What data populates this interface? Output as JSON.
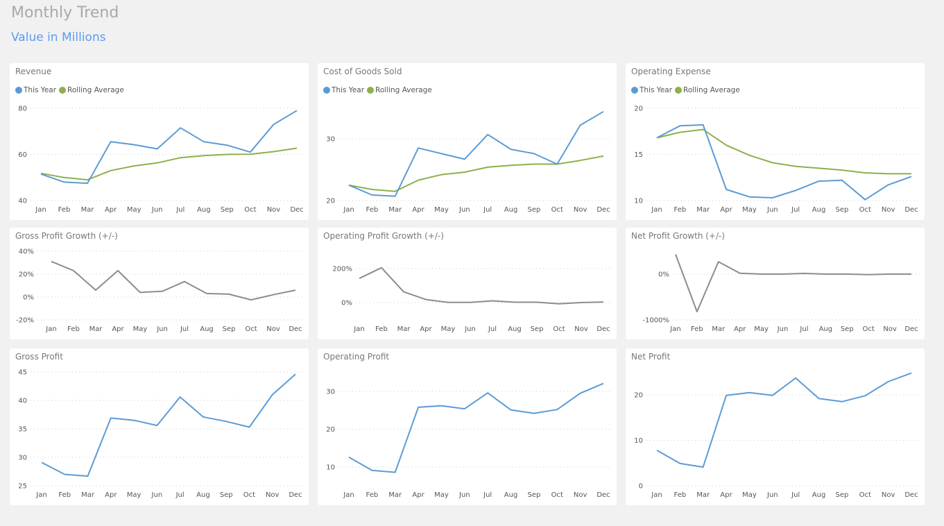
{
  "header": {
    "title": "Monthly Trend",
    "subtitle": "Value in Millions"
  },
  "colors": {
    "this_year": "#5b9bd5",
    "rolling_average": "#8db04a",
    "growth": "#8c8c8c"
  },
  "chart_data": [
    {
      "id": "revenue",
      "type": "line",
      "title": "Revenue",
      "categories": [
        "Jan",
        "Feb",
        "Mar",
        "Apr",
        "May",
        "Jun",
        "Jul",
        "Aug",
        "Sep",
        "Oct",
        "Nov",
        "Dec"
      ],
      "yticks": [
        {
          "v": 40,
          "label": "40"
        },
        {
          "v": 60,
          "label": "60"
        },
        {
          "v": 80,
          "label": "80"
        }
      ],
      "ylim": [
        40,
        80
      ],
      "legend": [
        "This Year",
        "Rolling Average"
      ],
      "series": [
        {
          "name": "This Year",
          "color": "#5b9bd5",
          "values": [
            51.5,
            48,
            47.5,
            65.5,
            64.2,
            62.4,
            71.5,
            65.5,
            64,
            61,
            73,
            79
          ]
        },
        {
          "name": "Rolling Average",
          "color": "#8db04a",
          "values": [
            51.8,
            50,
            49,
            53,
            55,
            56.3,
            58.6,
            59.5,
            60,
            60.1,
            61.2,
            62.7
          ]
        }
      ]
    },
    {
      "id": "cogs",
      "type": "line",
      "title": "Cost of Goods Sold",
      "categories": [
        "Jan",
        "Feb",
        "Mar",
        "Apr",
        "May",
        "Jun",
        "Jul",
        "Aug",
        "Sep",
        "Oct",
        "Nov",
        "Dec"
      ],
      "yticks": [
        {
          "v": 20,
          "label": "20"
        },
        {
          "v": 30,
          "label": "30"
        }
      ],
      "ylim": [
        20,
        30
      ],
      "legend": [
        "This Year",
        "Rolling Average"
      ],
      "series": [
        {
          "name": "This Year",
          "color": "#5b9bd5",
          "values": [
            22.5,
            20.9,
            20.7,
            28.5,
            27.6,
            26.7,
            30.7,
            28.3,
            27.6,
            25.9,
            32.2,
            34.4
          ]
        },
        {
          "name": "Rolling Average",
          "color": "#8db04a",
          "values": [
            22.5,
            21.8,
            21.5,
            23.3,
            24.2,
            24.6,
            25.4,
            25.7,
            25.9,
            25.9,
            26.5,
            27.2
          ]
        }
      ]
    },
    {
      "id": "opex",
      "type": "line",
      "title": "Operating Expense",
      "categories": [
        "Jan",
        "Feb",
        "Mar",
        "Apr",
        "May",
        "Jun",
        "Jul",
        "Aug",
        "Sep",
        "Oct",
        "Nov",
        "Dec"
      ],
      "yticks": [
        {
          "v": 10,
          "label": "10"
        },
        {
          "v": 15,
          "label": "15"
        },
        {
          "v": 20,
          "label": "20"
        }
      ],
      "ylim": [
        10,
        20
      ],
      "legend": [
        "This Year",
        "Rolling Average"
      ],
      "series": [
        {
          "name": "This Year",
          "color": "#5b9bd5",
          "values": [
            16.8,
            18.1,
            18.2,
            11.2,
            10.4,
            10.3,
            11.1,
            12.1,
            12.2,
            10.1,
            11.7,
            12.6
          ]
        },
        {
          "name": "Rolling Average",
          "color": "#8db04a",
          "values": [
            16.8,
            17.4,
            17.7,
            16.0,
            14.9,
            14.1,
            13.7,
            13.5,
            13.3,
            13.0,
            12.9,
            12.9
          ]
        }
      ]
    },
    {
      "id": "gross-profit-growth",
      "type": "line",
      "title": "Gross Profit Growth (+/-)",
      "categories": [
        "Jan",
        "Feb",
        "Mar",
        "Apr",
        "May",
        "Jun",
        "Jul",
        "Aug",
        "Sep",
        "Oct",
        "Nov",
        "Dec"
      ],
      "yticks": [
        {
          "v": -20,
          "label": "-20%"
        },
        {
          "v": 0,
          "label": "0%"
        },
        {
          "v": 20,
          "label": "20%"
        },
        {
          "v": 40,
          "label": "40%"
        }
      ],
      "ylim": [
        -20,
        40
      ],
      "unit": "%",
      "series": [
        {
          "name": "Gross Profit Growth",
          "color": "#8c8c8c",
          "values": [
            31,
            23,
            6,
            23,
            4,
            5,
            13.5,
            3,
            2.5,
            -2.5,
            2,
            6
          ]
        }
      ]
    },
    {
      "id": "operating-profit-growth",
      "type": "line",
      "title": "Operating Profit Growth (+/-)",
      "categories": [
        "Jan",
        "Feb",
        "Mar",
        "Apr",
        "May",
        "Jun",
        "Jul",
        "Aug",
        "Sep",
        "Oct",
        "Nov",
        "Dec"
      ],
      "yticks": [
        {
          "v": 0,
          "label": "0%"
        },
        {
          "v": 200,
          "label": "200%"
        }
      ],
      "ylim": [
        -135,
        345
      ],
      "unit": "%",
      "series": [
        {
          "name": "Operating Profit Growth",
          "color": "#8c8c8c",
          "values": [
            142,
            205,
            63,
            18,
            1,
            1,
            10,
            2,
            2,
            -7,
            0,
            3
          ]
        }
      ]
    },
    {
      "id": "net-profit-growth",
      "type": "line",
      "title": "Net Profit Growth (+/-)",
      "categories": [
        "Jan",
        "Feb",
        "Mar",
        "Apr",
        "May",
        "Jun",
        "Jul",
        "Aug",
        "Sep",
        "Oct",
        "Nov",
        "Dec"
      ],
      "yticks": [
        {
          "v": -1000,
          "label": "-1000%"
        },
        {
          "v": 0,
          "label": "0%"
        }
      ],
      "ylim": [
        -1000,
        500
      ],
      "unit": "%",
      "series": [
        {
          "name": "Net Profit Growth",
          "color": "#8c8c8c",
          "values": [
            430,
            -820,
            270,
            20,
            0,
            0,
            15,
            0,
            0,
            -10,
            0,
            0
          ]
        }
      ]
    },
    {
      "id": "gross-profit",
      "type": "line",
      "title": "Gross Profit",
      "categories": [
        "Jan",
        "Feb",
        "Mar",
        "Apr",
        "May",
        "Jun",
        "Jul",
        "Aug",
        "Sep",
        "Oct",
        "Nov",
        "Dec"
      ],
      "yticks": [
        {
          "v": 25,
          "label": "25"
        },
        {
          "v": 30,
          "label": "30"
        },
        {
          "v": 35,
          "label": "35"
        },
        {
          "v": 40,
          "label": "40"
        },
        {
          "v": 45,
          "label": "45"
        }
      ],
      "ylim": [
        25,
        45
      ],
      "series": [
        {
          "name": "Gross Profit",
          "color": "#5b9bd5",
          "values": [
            29.1,
            27.0,
            26.7,
            36.9,
            36.5,
            35.6,
            40.6,
            37.1,
            36.3,
            35.3,
            41.0,
            44.6
          ]
        }
      ]
    },
    {
      "id": "operating-profit",
      "type": "line",
      "title": "Operating Profit",
      "categories": [
        "Jan",
        "Feb",
        "Mar",
        "Apr",
        "May",
        "Jun",
        "Jul",
        "Aug",
        "Sep",
        "Oct",
        "Nov",
        "Dec"
      ],
      "yticks": [
        {
          "v": 10,
          "label": "10"
        },
        {
          "v": 20,
          "label": "20"
        },
        {
          "v": 30,
          "label": "30"
        }
      ],
      "ylim": [
        5,
        35
      ],
      "series": [
        {
          "name": "Operating Profit",
          "color": "#5b9bd5",
          "values": [
            12.6,
            9.1,
            8.6,
            25.8,
            26.2,
            25.4,
            29.6,
            25.1,
            24.2,
            25.2,
            29.5,
            32.1
          ]
        }
      ]
    },
    {
      "id": "net-profit",
      "type": "line",
      "title": "Net Profit",
      "categories": [
        "Jan",
        "Feb",
        "Mar",
        "Apr",
        "May",
        "Jun",
        "Jul",
        "Aug",
        "Sep",
        "Oct",
        "Nov",
        "Dec"
      ],
      "yticks": [
        {
          "v": 0,
          "label": "0"
        },
        {
          "v": 10,
          "label": "10"
        },
        {
          "v": 20,
          "label": "20"
        }
      ],
      "ylim": [
        0,
        25
      ],
      "series": [
        {
          "name": "Net Profit",
          "color": "#5b9bd5",
          "values": [
            7.8,
            4.9,
            4.1,
            19.9,
            20.5,
            19.9,
            23.7,
            19.2,
            18.5,
            19.8,
            22.9,
            24.8
          ]
        }
      ]
    }
  ]
}
